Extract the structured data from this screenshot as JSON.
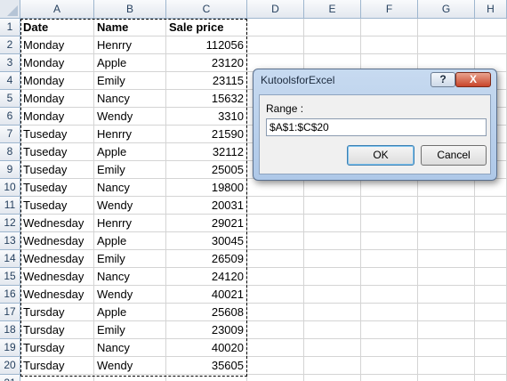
{
  "sheet": {
    "columns": [
      "A",
      "B",
      "C",
      "D",
      "E",
      "F",
      "G",
      "H"
    ],
    "rows": [
      [
        "Date",
        "Name",
        "Sale price"
      ],
      [
        "Monday",
        "Henrry",
        "112056"
      ],
      [
        "Monday",
        "Apple",
        "23120"
      ],
      [
        "Monday",
        "Emily",
        "23115"
      ],
      [
        "Monday",
        "Nancy",
        "15632"
      ],
      [
        "Monday",
        "Wendy",
        "3310"
      ],
      [
        "Tuseday",
        "Henrry",
        "21590"
      ],
      [
        "Tuseday",
        "Apple",
        "32112"
      ],
      [
        "Tuseday",
        "Emily",
        "25005"
      ],
      [
        "Tuseday",
        "Nancy",
        "19800"
      ],
      [
        "Tuseday",
        "Wendy",
        "20031"
      ],
      [
        "Wednesday",
        "Henrry",
        "29021"
      ],
      [
        "Wednesday",
        "Apple",
        "30045"
      ],
      [
        "Wednesday",
        "Emily",
        "26509"
      ],
      [
        "Wednesday",
        "Nancy",
        "24120"
      ],
      [
        "Wednesday",
        "Wendy",
        "40021"
      ],
      [
        "Tursday",
        "Apple",
        "25608"
      ],
      [
        "Tursday",
        "Emily",
        "23009"
      ],
      [
        "Tursday",
        "Nancy",
        "40020"
      ],
      [
        "Tursday",
        "Wendy",
        "35605"
      ]
    ]
  },
  "dialog": {
    "title": "KutoolsforExcel",
    "help_label": "?",
    "close_label": "X",
    "range_label": "Range :",
    "range_value": "$A$1:$C$20",
    "ok_label": "OK",
    "cancel_label": "Cancel"
  },
  "colors": {
    "header_border": "#9eb6ce",
    "grid": "#d4d4d4",
    "dialog_frame": "#aec8e8"
  }
}
